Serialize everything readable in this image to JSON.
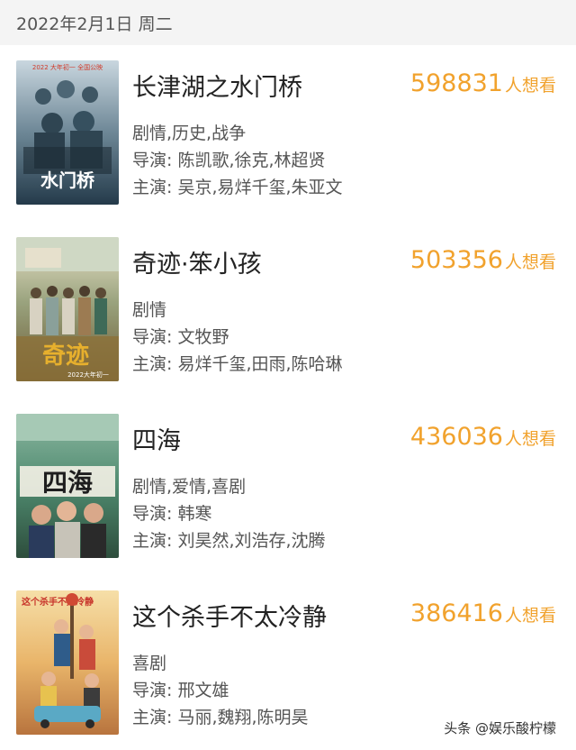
{
  "header": {
    "date": "2022年2月1日 周二"
  },
  "movies": [
    {
      "title": "长津湖之水门桥",
      "want_count": "598831",
      "want_label": "人想看",
      "genre": "剧情,历史,战争",
      "director": "导演: 陈凯歌,徐克,林超贤",
      "cast": "主演: 吴京,易烊千玺,朱亚文",
      "poster_text": "水门桥",
      "poster_top_text": "2022 大年初一 全国公映"
    },
    {
      "title": "奇迹·笨小孩",
      "want_count": "503356",
      "want_label": "人想看",
      "genre": "剧情",
      "director": "导演: 文牧野",
      "cast": "主演: 易烊千玺,田雨,陈哈琳",
      "poster_text": "奇迹",
      "poster_bottom_text": "2022大年初一"
    },
    {
      "title": "四海",
      "want_count": "436036",
      "want_label": "人想看",
      "genre": "剧情,爱情,喜剧",
      "director": "导演: 韩寒",
      "cast": "主演: 刘昊然,刘浩存,沈腾",
      "poster_text": "四海"
    },
    {
      "title": "这个杀手不太冷静",
      "want_count": "386416",
      "want_label": "人想看",
      "genre": "喜剧",
      "director": "导演: 邢文雄",
      "cast": "主演: 马丽,魏翔,陈明昊",
      "poster_text": "这个杀手不太冷静"
    }
  ],
  "watermark": "头条 @娱乐酸柠檬"
}
